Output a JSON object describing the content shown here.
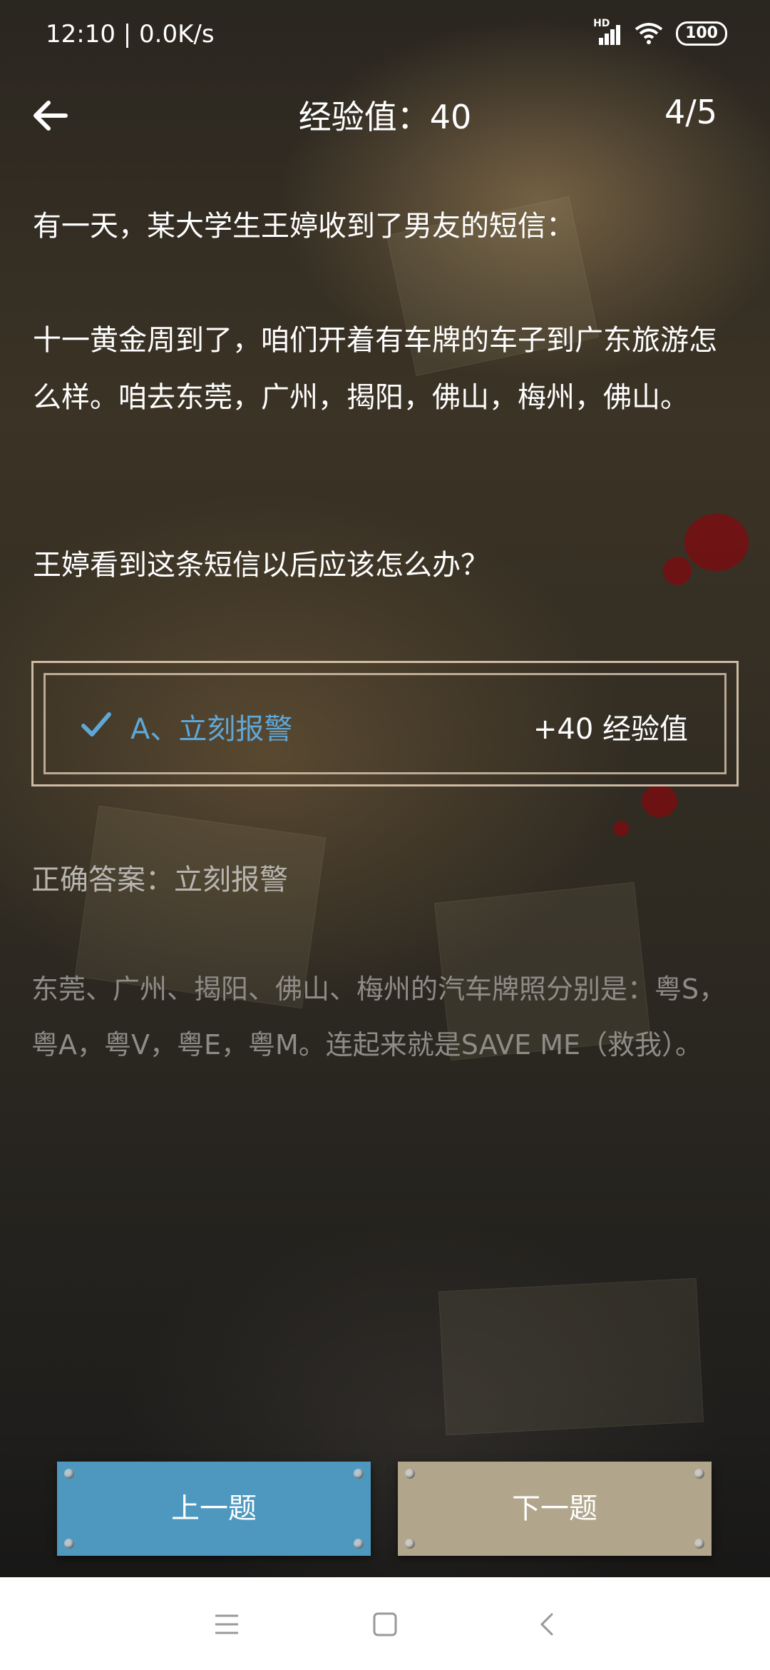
{
  "status_bar": {
    "time": "12:10 | 0.0K/s",
    "signal_badge": "HD",
    "battery": "100"
  },
  "header": {
    "title": "经验值：40",
    "progress": "4/5"
  },
  "question": {
    "intro": "有一天，某大学生王婷收到了男友的短信：",
    "message": "十一黄金周到了，咱们开着有车牌的车子到广东旅游怎么样。咱去东莞，广州，揭阳，佛山，梅州，佛山。",
    "ask": "王婷看到这条短信以后应该怎么办？"
  },
  "answer": {
    "label": "A、立刻报警",
    "reward": "+40 经验值",
    "label_color": "#5fa7d6"
  },
  "result": {
    "correct": "正确答案：立刻报警",
    "explanation": "东莞、广州、揭阳、佛山、梅州的汽车牌照分别是：粤S，粤A，粤V，粤E，粤M。连起来就是SAVE ME（救我）。"
  },
  "buttons": {
    "prev": "上一题",
    "next": "下一题",
    "prev_color": "#4e98bf",
    "next_color": "#b1a58c"
  },
  "nav_bar": {
    "icons": [
      "menu-icon",
      "home-square-icon",
      "back-chevron-icon"
    ]
  }
}
